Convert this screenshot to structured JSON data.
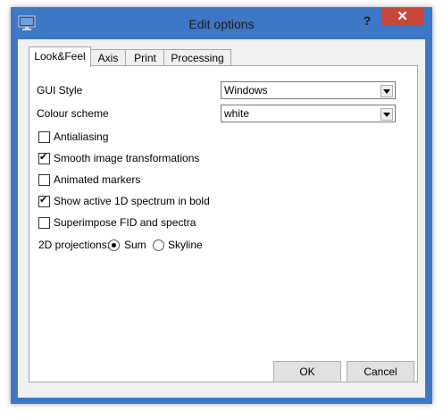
{
  "window": {
    "title": "Edit options",
    "help_label": "?",
    "close_label": "✕"
  },
  "tabs": [
    {
      "label": "Look&Feel",
      "active": true
    },
    {
      "label": "Axis"
    },
    {
      "label": "Print"
    },
    {
      "label": "Processing"
    }
  ],
  "look_feel": {
    "gui_style": {
      "label": "GUI Style",
      "value": "Windows"
    },
    "colour_scheme": {
      "label": "Colour scheme",
      "value": "white"
    },
    "checkboxes": [
      {
        "label": "Antialiasing",
        "checked": false
      },
      {
        "label": "Smooth image transformations",
        "checked": true
      },
      {
        "label": "Animated markers",
        "checked": false
      },
      {
        "label": "Show active 1D spectrum in bold",
        "checked": true
      },
      {
        "label": "Superimpose FID and spectra",
        "checked": false
      }
    ],
    "projections": {
      "label": "2D projections:",
      "options": [
        {
          "label": "Sum",
          "selected": true
        },
        {
          "label": "Skyline",
          "selected": false
        }
      ]
    }
  },
  "buttons": {
    "ok": "OK",
    "cancel": "Cancel"
  },
  "colors": {
    "titlebar": "#3e77c5",
    "close": "#c7473b"
  }
}
